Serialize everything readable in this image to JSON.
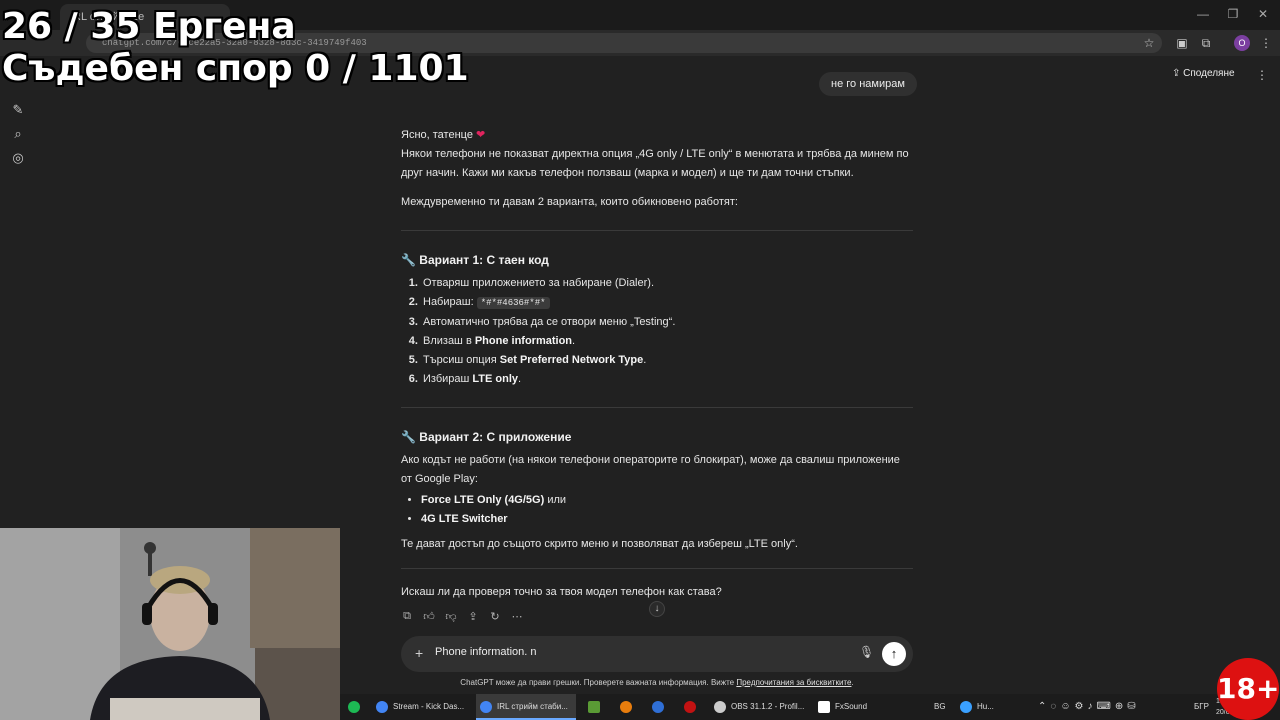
{
  "overlay": {
    "line1": "26 / 35 Ергена",
    "line2": "Съдебен спор 0 / 1101"
  },
  "browser": {
    "tab_title": "IRL стриймове",
    "address": "chatgpt.com/c/68ce22a5-32a0-8328-8d3c-3419749f403",
    "icons": [
      "star-icon",
      "extension-icon",
      "puzzle-icon",
      "profile-avatar",
      "menu-icon"
    ],
    "profile_letter": "O"
  },
  "header": {
    "share_label": "Споделяне",
    "share_icon": "share-icon"
  },
  "rail": [
    "edit-icon",
    "search-icon",
    "library-icon"
  ],
  "chat": {
    "user_message": "не го намирам",
    "greeting": "Ясно, татенце",
    "heart": "❤",
    "para1": "Някои телефони не показват директна опция „4G only / LTE only“ в менютата и трябва да минем по друг начин. Кажи ми какъв телефон ползваш (марка и модел) и ще ти дам точни стъпки.",
    "para2": "Междувременно ти давам 2 варианта, които обикновено работят:",
    "option1": {
      "icon": "🔧",
      "title": "Вариант 1: С таен код",
      "steps": [
        {
          "pre": "Отваряш приложението за набиране (Dialer).",
          "bold": "",
          "post": ""
        },
        {
          "pre": "Набираш: ",
          "code": "*#*#4636#*#*",
          "post": ""
        },
        {
          "pre": "Автоматично трябва да се отвори меню „Testing“.",
          "bold": "",
          "post": ""
        },
        {
          "pre": "Влизаш в ",
          "bold": "Phone information",
          "post": "."
        },
        {
          "pre": "Търсиш опция ",
          "bold": "Set Preferred Network Type",
          "post": "."
        },
        {
          "pre": "Избираш ",
          "bold": "LTE only",
          "post": "."
        }
      ]
    },
    "option2": {
      "icon": "🔧",
      "title": "Вариант 2: С приложение",
      "intro": "Ако кодът не работи (на някои телефони операторите го блокират), може да свалиш приложение от Google Play:",
      "apps": [
        {
          "bold": "Force LTE Only (4G/5G)",
          "post": " или"
        },
        {
          "bold": "4G LTE Switcher",
          "post": ""
        }
      ],
      "outro": "Те дават достъп до същото скрито меню и позволяват да избереш „LTE only“."
    },
    "question": "Искаш ли да проверя точно за твоя модел телефон как става?",
    "actions": [
      "copy-icon",
      "thumbs-up-icon",
      "thumbs-down-icon",
      "share-icon",
      "regenerate-icon",
      "more-icon"
    ]
  },
  "composer": {
    "value": "Phone information. n",
    "disclaimer": "ChatGPT може да прави грешки. Проверете важната информация. Вижте ",
    "disclaimer_link": "Предпочитания за бисквитките",
    "disclaimer_end": "."
  },
  "taskbar": {
    "items": [
      {
        "label": "Stream - Kick Das...",
        "color": "#4285f4"
      },
      {
        "label": "IRL стрийм стаби...",
        "color": "#4285f4"
      },
      {
        "label": "OBS 31.1.2 - Profil...",
        "color": "#cccccc"
      },
      {
        "label": "FxSound",
        "color": "#ffffff"
      },
      {
        "label": "Hu...",
        "color": "#3aa0ff"
      }
    ],
    "lang": "BG",
    "lang2": "БГР",
    "time": "16:",
    "date": "20/09/20"
  },
  "badge": "18+"
}
